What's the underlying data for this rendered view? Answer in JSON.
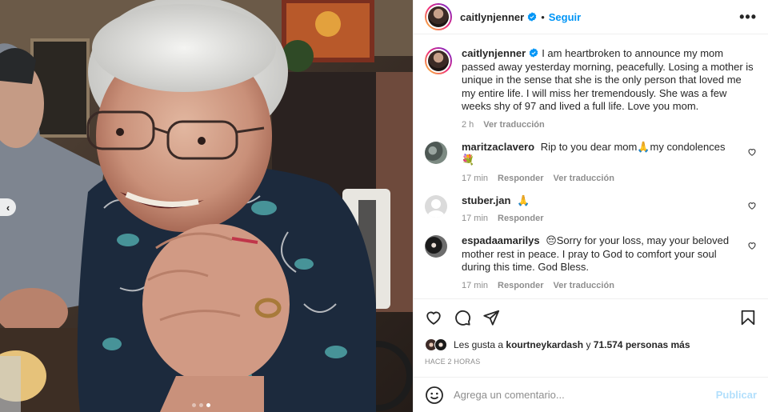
{
  "header": {
    "username": "caitlynjenner",
    "separator": "•",
    "follow_label": "Seguir",
    "more_label": "•••"
  },
  "caption": {
    "username": "caitlynjenner",
    "text": "I am heartbroken to announce my mom passed away yesterday morning, peacefully. Losing a mother is unique in the sense that she is the only person that loved me my entire life. I will miss her tremendously. She was a few weeks shy of 97 and lived a full life. Love you mom.",
    "time": "2 h",
    "translate_label": "Ver traducción"
  },
  "comments": [
    {
      "username": "maritzaclavero",
      "text": "Rip to you dear mom🙏my condolences 💐",
      "time": "17 min",
      "reply_label": "Responder",
      "translate_label": "Ver traducción"
    },
    {
      "username": "stuber.jan",
      "text": "🙏",
      "time": "17 min",
      "reply_label": "Responder"
    },
    {
      "username": "espadaamarilys",
      "text": "😔Sorry for your loss, may your beloved mother rest in peace. I pray to God to comfort your soul during this time. God Bless.",
      "time": "17 min",
      "reply_label": "Responder",
      "translate_label": "Ver traducción"
    }
  ],
  "likes": {
    "prefix": "Les gusta a",
    "first_user": "kourtneykardash",
    "conjunction": "y",
    "count": "71.574 personas más"
  },
  "posted_ago": "HACE 2 HORAS",
  "add_comment": {
    "placeholder": "Agrega un comentario...",
    "publish_label": "Publicar"
  },
  "media": {
    "prev_label": "‹",
    "carousel_dots": 3,
    "active_dot": 2
  },
  "colors": {
    "link_blue": "#0095f6",
    "publish_disabled": "#b2dffc",
    "muted_text": "#8e8e8e",
    "verified_blue": "#0095f6"
  }
}
